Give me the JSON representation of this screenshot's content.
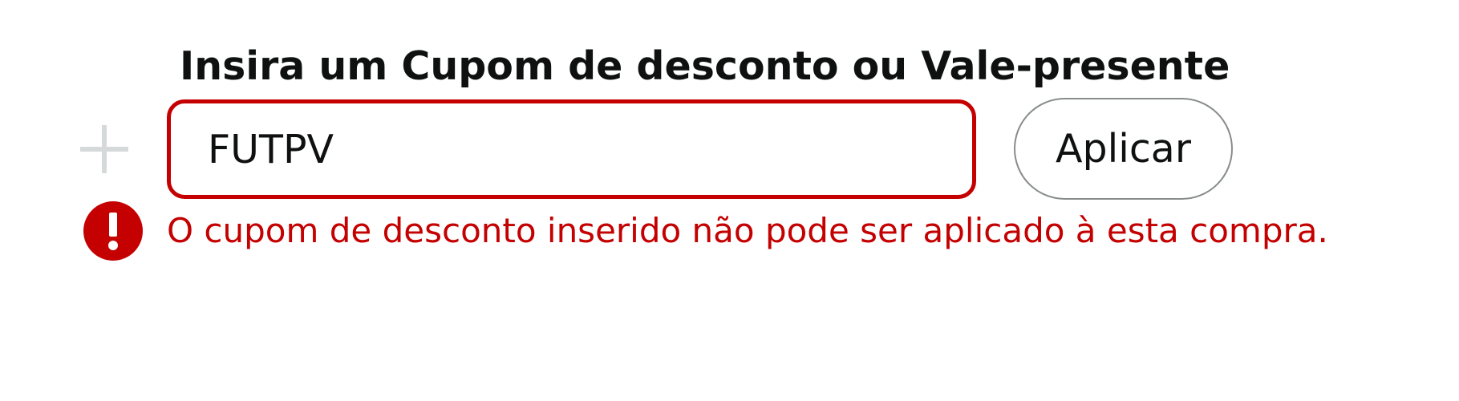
{
  "coupon_form": {
    "title": "Insira um Cupom de desconto ou Vale-presente",
    "input_value": "FUTPV",
    "apply_label": "Aplicar",
    "error_message": "O cupom de desconto inserido não pode ser aplicado à esta compra."
  },
  "icons": {
    "expand": "plus-icon",
    "error": "exclamation-circle-icon"
  },
  "colors": {
    "error": "#c40000",
    "text": "#0f1111",
    "button_border": "#888c8c",
    "plus_icon": "#d5d9d9",
    "background": "#ffffff"
  }
}
